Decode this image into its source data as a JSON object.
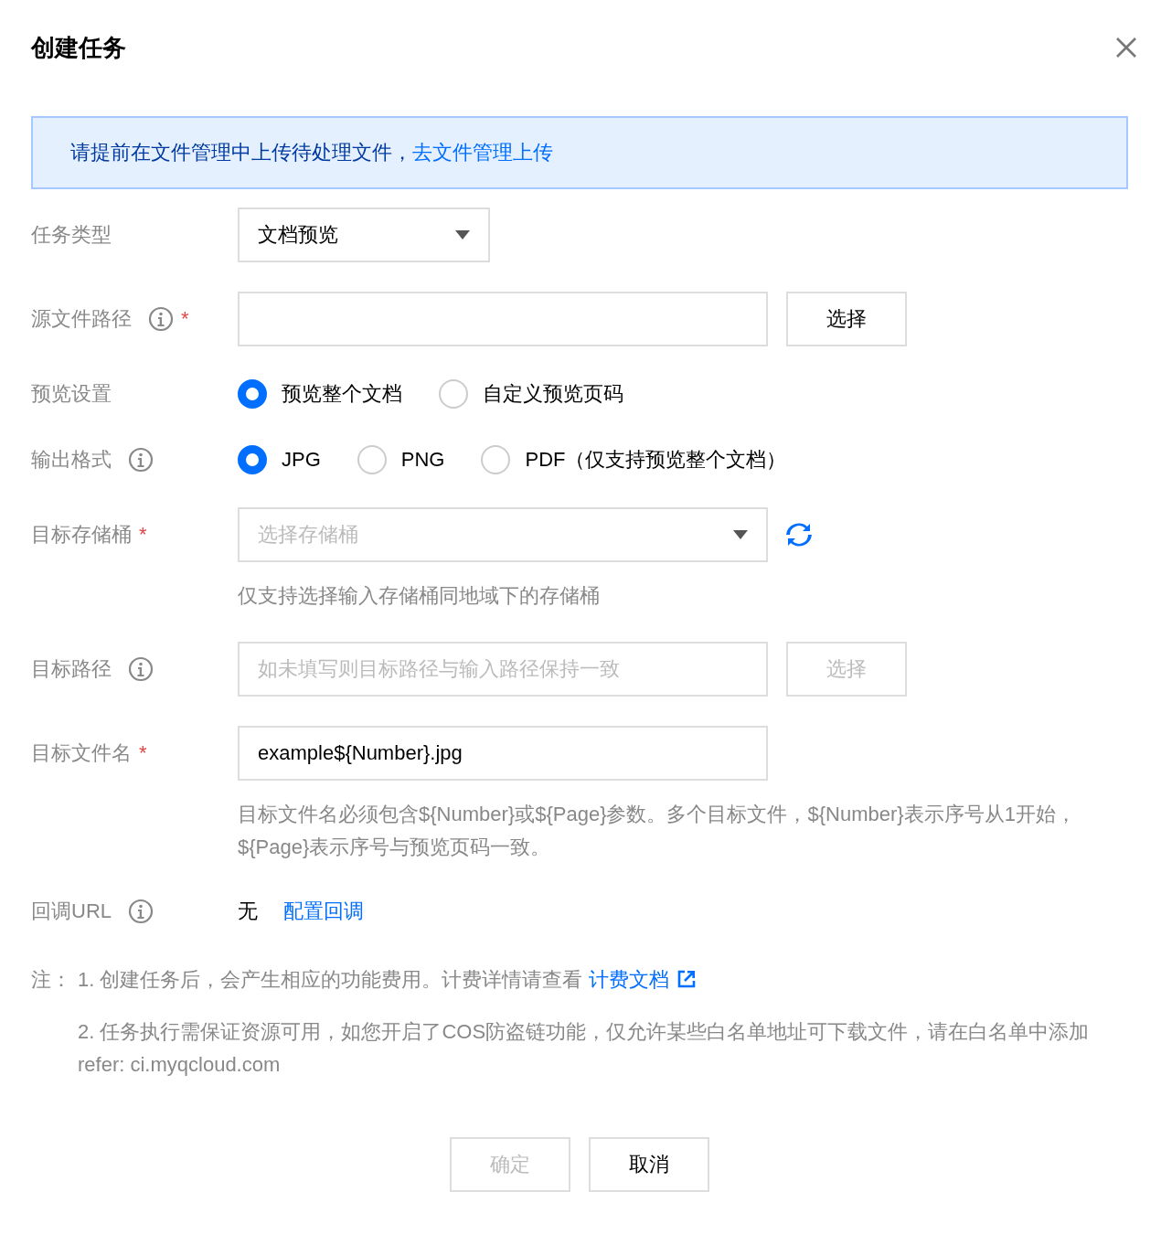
{
  "dialog": {
    "title": "创建任务"
  },
  "notice": {
    "text": "请提前在文件管理中上传待处理文件，",
    "link": "去文件管理上传"
  },
  "fields": [
    {
      "kind": "select",
      "label": "任务类型",
      "value": "文档预览"
    },
    {
      "kind": "input",
      "label": "源文件路径",
      "info": true,
      "required": "*",
      "button": {
        "label": "选择",
        "disabled": false
      }
    },
    {
      "kind": "radio",
      "label": "预览设置",
      "options": [
        {
          "label": "预览整个文档",
          "selected": true
        },
        {
          "label": "自定义预览页码",
          "selected": false
        }
      ]
    },
    {
      "kind": "radio",
      "label": "输出格式",
      "info": true,
      "options": [
        {
          "label": "JPG",
          "selected": true
        },
        {
          "label": "PNG",
          "selected": false
        },
        {
          "label": "PDF（仅支持预览整个文档）",
          "selected": false
        }
      ]
    },
    {
      "kind": "select",
      "label": "目标存储桶",
      "required": "*",
      "placeholder": "选择存储桶",
      "refresh": true,
      "help": "仅支持选择输入存储桶同地域下的存储桶"
    },
    {
      "kind": "input",
      "label": "目标路径",
      "info": true,
      "placeholder": "如未填写则目标路径与输入路径保持一致",
      "button": {
        "label": "选择",
        "disabled": true
      }
    },
    {
      "kind": "input",
      "label": "目标文件名",
      "required": "*",
      "value": "example${Number}.jpg",
      "help": "目标文件名必须包含${Number}或${Page}参数。多个目标文件，${Number}表示序号从1开始，${Page}表示序号与预览页码一致。"
    },
    {
      "kind": "text",
      "label": "回调URL",
      "info": true,
      "value": "无",
      "link": "配置回调"
    }
  ],
  "notes": {
    "prefix": "注：",
    "items": [
      {
        "text": "1. 创建任务后，会产生相应的功能费用。计费详情请查看",
        "link": "计费文档"
      },
      {
        "text": "2. 任务执行需保证资源可用，如您开启了COS防盗链功能，仅允许某些白名单地址可下载文件，请在白名单中添加refer: ci.myqcloud.com"
      }
    ]
  },
  "buttons": [
    {
      "label": "确定",
      "disabled": true
    },
    {
      "label": "取消",
      "disabled": false
    }
  ]
}
